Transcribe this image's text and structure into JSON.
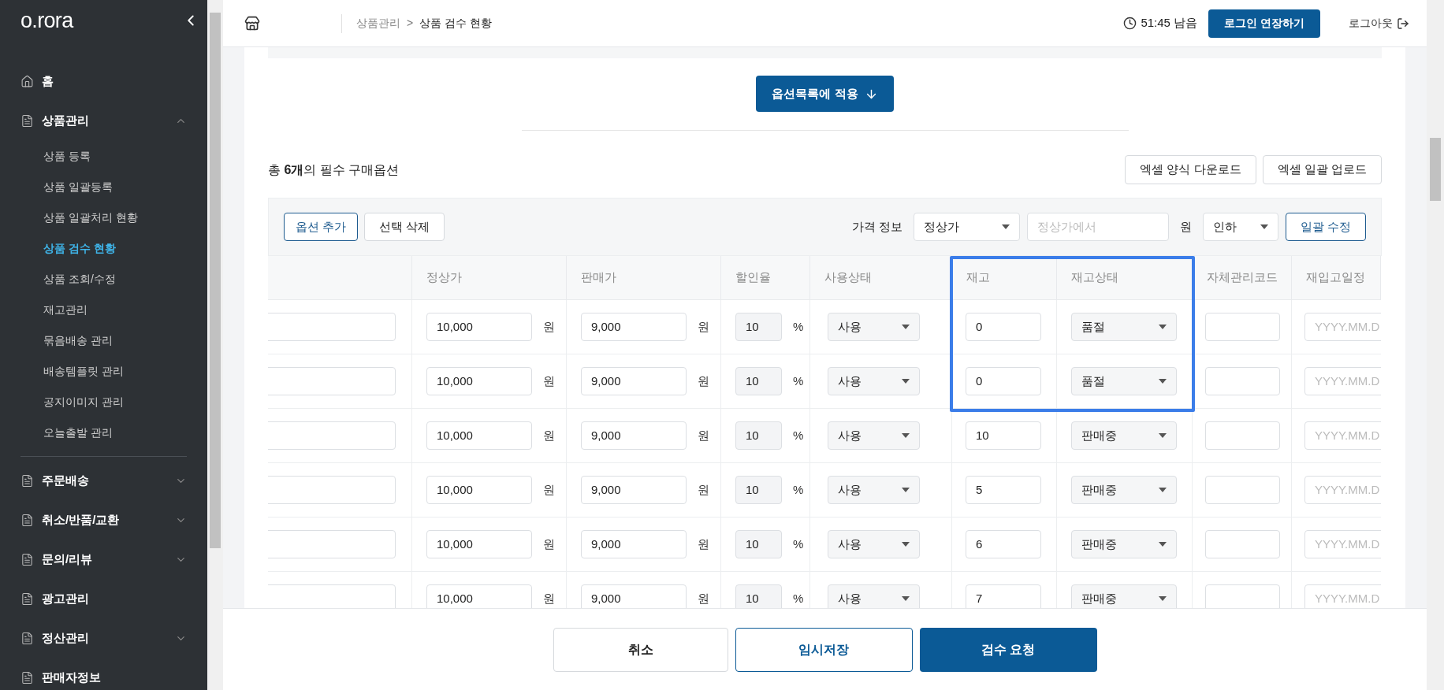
{
  "sidebar": {
    "logo": "o.rora",
    "items": [
      {
        "label": "홈",
        "kind": "home"
      },
      {
        "label": "상품관리",
        "kind": "group",
        "expanded": true,
        "children": [
          {
            "label": "상품 등록",
            "selected": false
          },
          {
            "label": "상품 일괄등록",
            "selected": false
          },
          {
            "label": "상품 일괄처리 현황",
            "selected": false
          },
          {
            "label": "상품 검수 현황",
            "selected": true
          },
          {
            "label": "상품 조회/수정",
            "selected": false
          },
          {
            "label": "재고관리",
            "selected": false
          },
          {
            "label": "묶음배송 관리",
            "selected": false
          },
          {
            "label": "배송템플릿 관리",
            "selected": false
          },
          {
            "label": "공지이미지 관리",
            "selected": false
          },
          {
            "label": "오늘출발 관리",
            "selected": false
          }
        ]
      },
      {
        "label": "주문배송",
        "kind": "group",
        "expanded": false
      },
      {
        "label": "취소/반품/교환",
        "kind": "group",
        "expanded": false
      },
      {
        "label": "문의/리뷰",
        "kind": "group",
        "expanded": false
      },
      {
        "label": "광고관리",
        "kind": "group"
      },
      {
        "label": "정산관리",
        "kind": "group",
        "expanded": false
      },
      {
        "label": "판매자정보",
        "kind": "group"
      }
    ]
  },
  "header": {
    "breadcrumb": [
      "상품관리",
      "상품 검수 현황"
    ],
    "separator": ">",
    "timer": "51:45 남음",
    "extend_button": "로그인 연장하기",
    "logout": "로그아웃"
  },
  "apply_button": "옵션목록에 적용",
  "summary": {
    "prefix": "총 ",
    "count": "6개",
    "suffix": "의 필수 구매옵션"
  },
  "excel_buttons": [
    "엑셀 양식 다운로드",
    "엑셀 일괄 업로드"
  ],
  "toolbar": {
    "add_button": "옵션 추가",
    "delete_button": "선택 삭제",
    "price_label": "가격 정보",
    "price_select": "정상가",
    "amount_placeholder": "정상가에서",
    "unit": "원",
    "direction_select": "인하",
    "apply_button": "일괄 수정"
  },
  "table": {
    "columns": [
      {
        "label": "정상가"
      },
      {
        "label": "판매가"
      },
      {
        "label": "할인율"
      },
      {
        "label": "사용상태"
      },
      {
        "label": "재고"
      },
      {
        "label": "재고상태"
      },
      {
        "label": "자체관리코드"
      },
      {
        "label": "재입고일정"
      }
    ],
    "rows": [
      {
        "regular_price": "10,000",
        "regular_unit": "원",
        "sale_price": "9,000",
        "sale_unit": "원",
        "discount": "10",
        "discount_unit": "%",
        "use_status": "사용",
        "stock": "0",
        "stock_status": "품절",
        "restock_placeholder": "YYYY.MM.D"
      },
      {
        "regular_price": "10,000",
        "regular_unit": "원",
        "sale_price": "9,000",
        "sale_unit": "원",
        "discount": "10",
        "discount_unit": "%",
        "use_status": "사용",
        "stock": "0",
        "stock_status": "품절",
        "restock_placeholder": "YYYY.MM.D"
      },
      {
        "regular_price": "10,000",
        "regular_unit": "원",
        "sale_price": "9,000",
        "sale_unit": "원",
        "discount": "10",
        "discount_unit": "%",
        "use_status": "사용",
        "stock": "10",
        "stock_status": "판매중",
        "restock_placeholder": "YYYY.MM.D"
      },
      {
        "regular_price": "10,000",
        "regular_unit": "원",
        "sale_price": "9,000",
        "sale_unit": "원",
        "discount": "10",
        "discount_unit": "%",
        "use_status": "사용",
        "stock": "5",
        "stock_status": "판매중",
        "restock_placeholder": "YYYY.MM.D"
      },
      {
        "regular_price": "10,000",
        "regular_unit": "원",
        "sale_price": "9,000",
        "sale_unit": "원",
        "discount": "10",
        "discount_unit": "%",
        "use_status": "사용",
        "stock": "6",
        "stock_status": "판매중",
        "restock_placeholder": "YYYY.MM.D"
      },
      {
        "regular_price": "10,000",
        "regular_unit": "원",
        "sale_price": "9,000",
        "sale_unit": "원",
        "discount": "10",
        "discount_unit": "%",
        "use_status": "사용",
        "stock": "7",
        "stock_status": "판매중",
        "restock_placeholder": "YYYY.MM.D"
      }
    ]
  },
  "footer": {
    "cancel_button": "취소",
    "save_button": "임시저장",
    "submit_button": "검수 요청"
  }
}
